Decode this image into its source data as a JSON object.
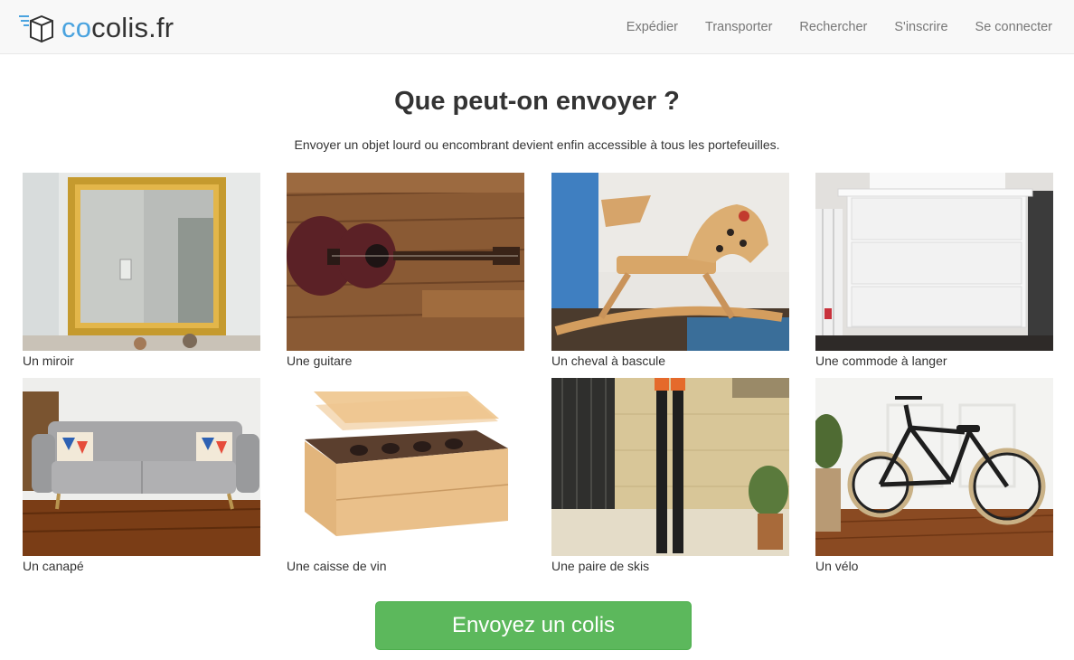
{
  "brand": {
    "prefix": "co",
    "suffix": "colis.fr"
  },
  "nav": {
    "items": [
      {
        "label": "Expédier"
      },
      {
        "label": "Transporter"
      },
      {
        "label": "Rechercher"
      },
      {
        "label": "S'inscrire"
      },
      {
        "label": "Se connecter"
      }
    ]
  },
  "main": {
    "title": "Que peut-on envoyer ?",
    "subtitle": "Envoyer un objet lourd ou encombrant devient enfin accessible à tous les portefeuilles.",
    "items": [
      {
        "caption": "Un miroir"
      },
      {
        "caption": "Une guitare"
      },
      {
        "caption": "Un cheval à bascule"
      },
      {
        "caption": "Une commode à langer"
      },
      {
        "caption": "Un canapé"
      },
      {
        "caption": "Une caisse de vin"
      },
      {
        "caption": "Une paire de skis"
      },
      {
        "caption": "Un vélo"
      }
    ],
    "cta_label": "Envoyez un colis"
  },
  "colors": {
    "brand_blue": "#4aa3df",
    "cta_green": "#5cb85c"
  }
}
